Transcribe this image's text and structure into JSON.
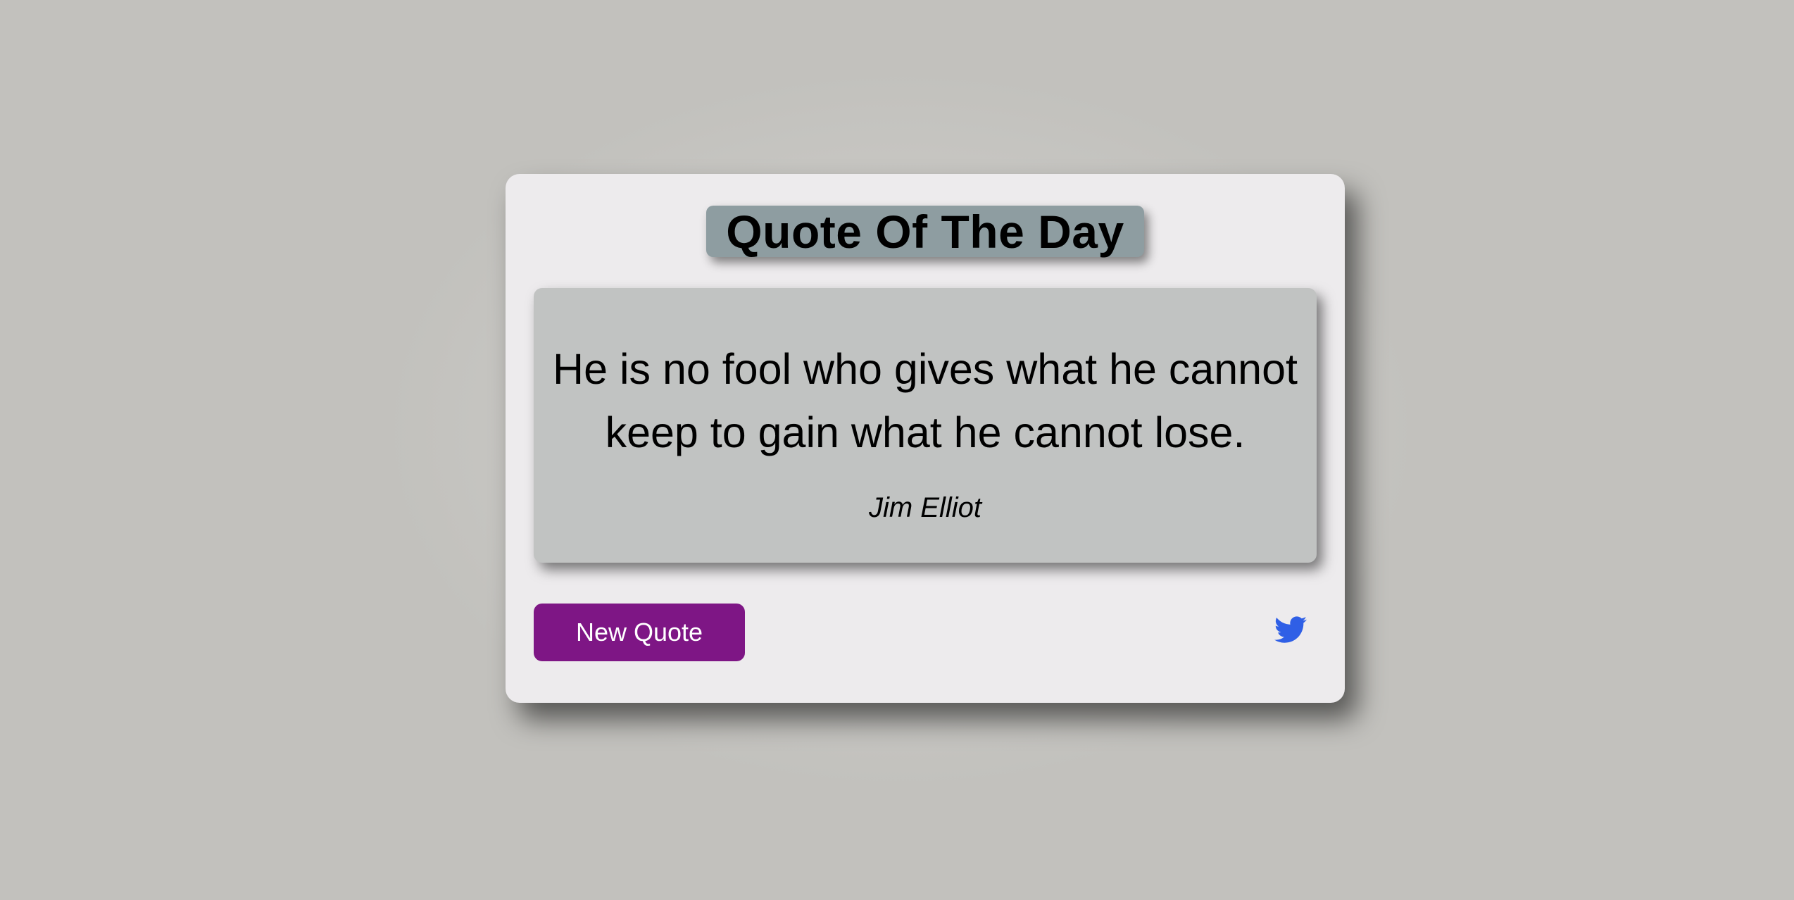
{
  "page": {
    "background_color": "#c2c1bd"
  },
  "card": {
    "title": "Quote Of The Day",
    "quote": {
      "text": "He is no fool who gives what he cannot keep to gain what he cannot lose.",
      "author": "Jim Elliot"
    },
    "actions": {
      "new_quote_label": "New Quote",
      "tweet_icon": "twitter-icon"
    }
  },
  "colors": {
    "card_bg": "#edebed",
    "title_bg": "#8e9da1",
    "quote_bg": "#c1c3c2",
    "button_bg": "#7e1685",
    "twitter_blue": "#2f5fe6"
  }
}
